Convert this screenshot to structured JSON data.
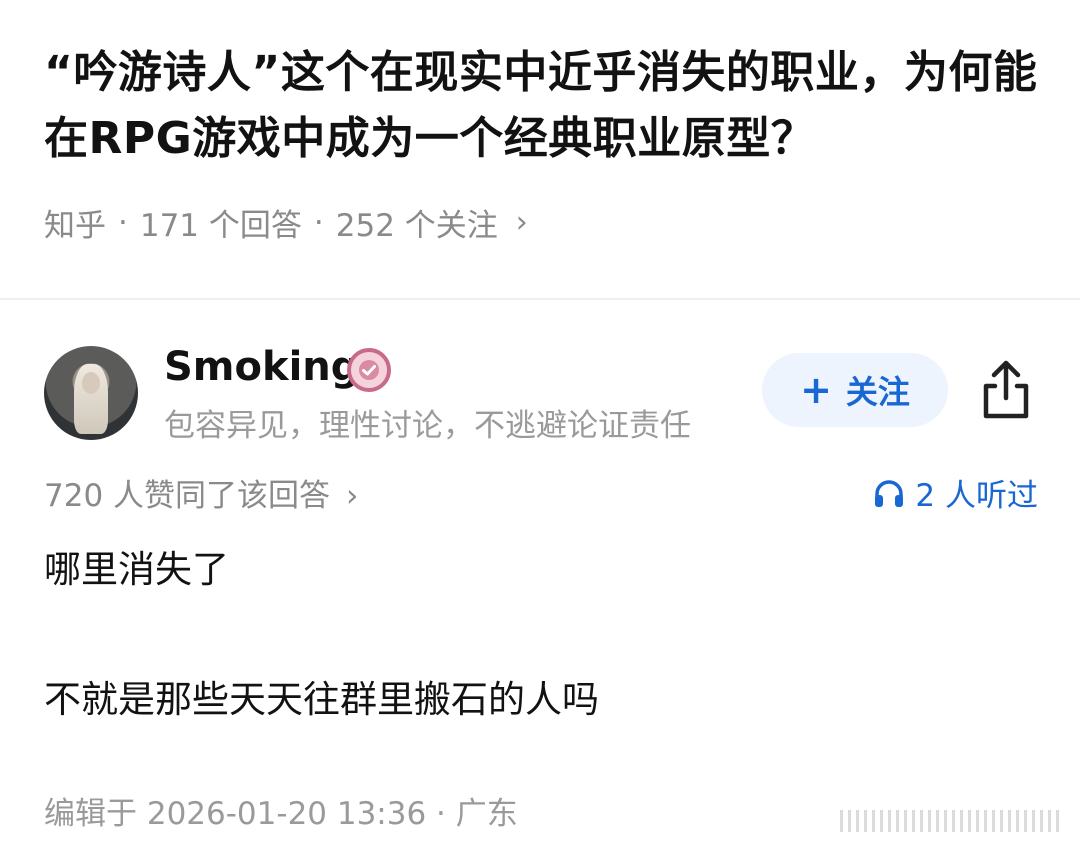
{
  "question": {
    "title": "“吟游诗人”这个在现实中近乎消失的职业，为何能在RPG游戏中成为一个经典职业原型？",
    "source": "知乎",
    "answer_count": "171 个回答",
    "follower_count": "252 个关注"
  },
  "author": {
    "name": "Smoking",
    "bio": "包容异见，理性讨论，不逃避论证责任",
    "follow_label": "关注"
  },
  "stats": {
    "agree": "720 人赞同了该回答",
    "listen": "2 人听过"
  },
  "answer": {
    "paragraphs": [
      "哪里消失了",
      "不就是那些天天往群里搬石的人吗"
    ]
  },
  "footer": {
    "edit_info": "编辑于 2026-01-20 13:36 · 广东"
  },
  "colors": {
    "accent": "#1967d2",
    "muted": "#8a8a8a",
    "follow_bg": "#eef4fd"
  },
  "icons": [
    "chevron-right-icon",
    "verified-badge-icon",
    "plus-icon",
    "share-icon",
    "headphones-icon"
  ]
}
